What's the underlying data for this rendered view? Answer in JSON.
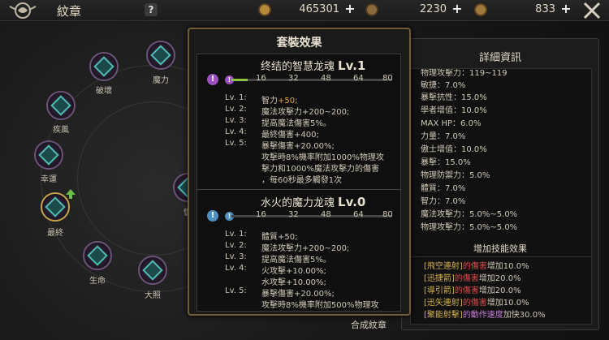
{
  "header": {
    "title": "紋章",
    "help_label": "?",
    "currency_1": "465301",
    "currency_2": "2230",
    "currency_3": "833"
  },
  "nodes": [
    {
      "label": "破壞"
    },
    {
      "label": "魔力"
    },
    {
      "label": "疾風"
    },
    {
      "label": "幸運"
    },
    {
      "label": "最終"
    },
    {
      "label": "生命"
    },
    {
      "label": "大照"
    },
    {
      "label": "慍"
    }
  ],
  "popup": {
    "title": "套裝效果",
    "set1": {
      "name": "终结的智慧龙魂",
      "level": "Lv.1",
      "progress_value": 16,
      "progress_max": 80,
      "ticks": [
        "16",
        "32",
        "48",
        "64",
        "80"
      ],
      "lines": [
        {
          "lv": "Lv. 1:",
          "text": "智力",
          "num": "+50;"
        },
        {
          "lv": "Lv. 2:",
          "text": "魔法攻擊力+200~200;",
          "num": ""
        },
        {
          "lv": "Lv. 3:",
          "text": "提高魔法傷害5%。",
          "num": ""
        },
        {
          "lv": "Lv. 4:",
          "text": "最終傷害+400;",
          "num": ""
        },
        {
          "lv": "Lv. 5:",
          "text": "暴擊傷害+20.00%;",
          "num": ""
        },
        {
          "lv": "",
          "text": "攻擊時8%機率附加1000%物理攻",
          "num": ""
        },
        {
          "lv": "",
          "text": "擊力和1000%魔法攻擊力的傷害",
          "num": ""
        },
        {
          "lv": "",
          "text": "，每60秒最多觸發1次",
          "num": ""
        }
      ]
    },
    "set2": {
      "name": "水火的魔力龙魂",
      "level": "Lv.0",
      "progress_value": 0,
      "progress_max": 80,
      "ticks": [
        "16",
        "32",
        "48",
        "64",
        "80"
      ],
      "lines": [
        {
          "lv": "Lv. 1:",
          "text": "體質+50;"
        },
        {
          "lv": "Lv. 2:",
          "text": "魔法攻擊力+200~200;"
        },
        {
          "lv": "Lv. 3:",
          "text": "提高魔法傷害5%。"
        },
        {
          "lv": "Lv. 4:",
          "text": "火攻擊+10.00%;"
        },
        {
          "lv": "",
          "text": "水攻擊+10.00%;"
        },
        {
          "lv": "Lv. 5:",
          "text": "暴擊傷害+20.00%;"
        },
        {
          "lv": "",
          "text": "攻擊時8%機率附加500%物理攻"
        }
      ]
    }
  },
  "detail": {
    "title": "詳細資訊",
    "rows": [
      "物理攻擊力：119~119",
      "敏捷：7.0%",
      "暴擊抗性：15.0%",
      "學者增值：10.0%",
      "MAX HP：6.0%",
      "力量：7.0%",
      "傲士增值：10.0%",
      "暴擊：15.0%",
      "物理防禦力：5.0%",
      "體質：7.0%",
      "智力：7.0%",
      "魔法攻擊力：5.0%~5.0%",
      "物理攻擊力：5.0%~5.0%"
    ],
    "effects_title": "增加技能效果",
    "effects": [
      {
        "skill": "[飛空連射]",
        "mid": "的傷害",
        "tail": "增加10.0%",
        "kind": "hi"
      },
      {
        "skill": "[迅捷箭]",
        "mid": "的傷害",
        "tail": "增加20.0%",
        "kind": "hi"
      },
      {
        "skill": "[導引箭]",
        "mid": "的傷害",
        "tail": "增加20.0%",
        "kind": "hi"
      },
      {
        "skill": "[迅矢連射]",
        "mid": "的傷害",
        "tail": "增加10.0%",
        "kind": "hi"
      },
      {
        "skill": "[聚能射擊]",
        "mid": "的動作速度",
        "tail": "加快30.0%",
        "kind": "hm"
      }
    ]
  },
  "footer": {
    "compose_label": "合成紋章"
  }
}
